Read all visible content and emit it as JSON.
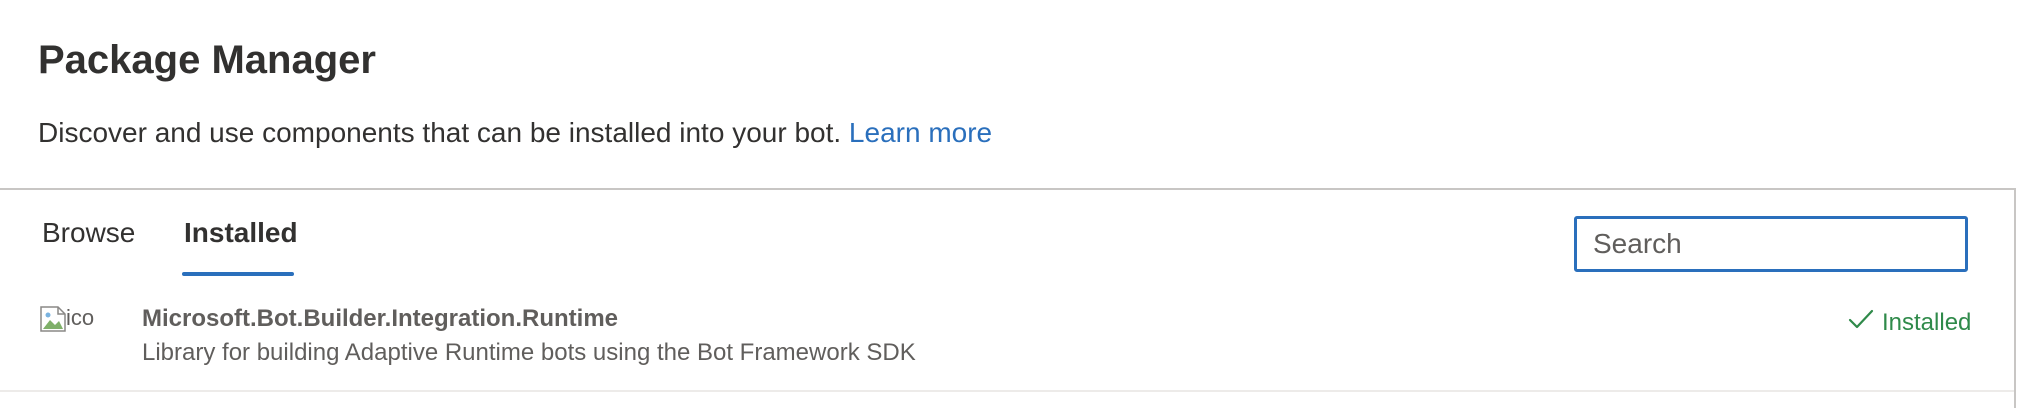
{
  "header": {
    "title": "Package Manager",
    "subtitle": "Discover and use components that can be installed into your bot.",
    "learn_more": "Learn more"
  },
  "tabs": [
    {
      "label": "Browse",
      "selected": false
    },
    {
      "label": "Installed",
      "selected": true
    }
  ],
  "search": {
    "placeholder": "Search",
    "value": ""
  },
  "packages": [
    {
      "icon_alt": "ico",
      "icon": "broken-image-icon",
      "name": "Microsoft.Bot.Builder.Integration.Runtime",
      "description": "Library for building Adaptive Runtime bots using the Bot Framework SDK",
      "status": "Installed",
      "status_icon": "check-icon"
    }
  ],
  "colors": {
    "accent": "#2a6fbc",
    "installed": "#2f8a4a",
    "text": "#323130",
    "muted": "#605e5c"
  }
}
